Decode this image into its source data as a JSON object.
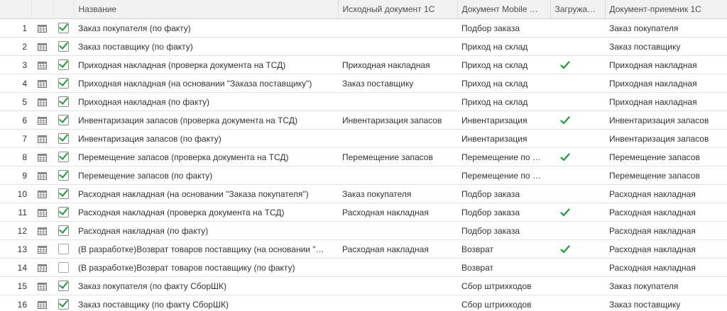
{
  "columns": {
    "name": "Название",
    "source_doc": "Исходный документ 1С",
    "mobile_doc": "Документ Mobile …",
    "loaded": "Загружа…",
    "target_doc": "Документ-приемник 1С"
  },
  "rows": [
    {
      "num": "1",
      "checked": true,
      "name": "Заказ покупателя (по факту)",
      "source_doc": "",
      "mobile_doc": "Подбор заказа",
      "loaded": false,
      "target_doc": "Заказ покупателя"
    },
    {
      "num": "2",
      "checked": true,
      "name": "Заказ поставщику (по факту)",
      "source_doc": "",
      "mobile_doc": "Приход на склад",
      "loaded": false,
      "target_doc": "Заказ поставщику"
    },
    {
      "num": "3",
      "checked": true,
      "name": "Приходная накладная (проверка документа на ТСД)",
      "source_doc": "Приходная накладная",
      "mobile_doc": "Приход на склад",
      "loaded": true,
      "target_doc": "Приходная накладная"
    },
    {
      "num": "4",
      "checked": true,
      "name": "Приходная накладная (на основании \"Заказа поставщику\")",
      "source_doc": "Заказ поставщику",
      "mobile_doc": "Приход на склад",
      "loaded": false,
      "target_doc": "Приходная накладная"
    },
    {
      "num": "5",
      "checked": true,
      "name": "Приходная накладная (по факту)",
      "source_doc": "",
      "mobile_doc": "Приход на склад",
      "loaded": false,
      "target_doc": "Приходная накладная"
    },
    {
      "num": "6",
      "checked": true,
      "name": "Инвентаризация запасов (проверка документа на ТСД)",
      "source_doc": "Инвентаризация запасов",
      "mobile_doc": "Инвентаризация",
      "loaded": true,
      "target_doc": "Инвентаризация запасов"
    },
    {
      "num": "7",
      "checked": true,
      "name": "Инвентаризация запасов (по факту)",
      "source_doc": "",
      "mobile_doc": "Инвентаризация",
      "loaded": false,
      "target_doc": "Инвентаризация запасов"
    },
    {
      "num": "8",
      "checked": true,
      "name": "Перемещение запасов (проверка документа на ТСД)",
      "source_doc": "Перемещение запасов",
      "mobile_doc": "Перемещение по …",
      "loaded": true,
      "target_doc": "Перемещение запасов"
    },
    {
      "num": "9",
      "checked": true,
      "name": "Перемещение запасов (по факту)",
      "source_doc": "",
      "mobile_doc": "Перемещение по …",
      "loaded": false,
      "target_doc": "Перемещение запасов"
    },
    {
      "num": "10",
      "checked": true,
      "name": "Расходная накладная (на основании \"Заказа покупателя\")",
      "source_doc": "Заказ покупателя",
      "mobile_doc": "Подбор заказа",
      "loaded": false,
      "target_doc": "Расходная накладная"
    },
    {
      "num": "11",
      "checked": true,
      "name": "Расходная накладная (проверка документа на ТСД)",
      "source_doc": "Расходная накладная",
      "mobile_doc": "Подбор заказа",
      "loaded": true,
      "target_doc": "Расходная накладная"
    },
    {
      "num": "12",
      "checked": true,
      "name": "Расходная накладная (по факту)",
      "source_doc": "",
      "mobile_doc": "Подбор заказа",
      "loaded": false,
      "target_doc": "Расходная накладная"
    },
    {
      "num": "13",
      "checked": false,
      "name": "(В разработке)Возврат товаров поставщику (на основании \"…",
      "source_doc": "Расходная накладная",
      "mobile_doc": "Возврат",
      "loaded": true,
      "target_doc": "Расходная накладная"
    },
    {
      "num": "14",
      "checked": false,
      "name": "(В разработке)Возврат товаров поставщику (по факту)",
      "source_doc": "",
      "mobile_doc": "Возврат",
      "loaded": false,
      "target_doc": "Расходная накладная"
    },
    {
      "num": "15",
      "checked": true,
      "name": "Заказ покупателя (по факту СборШК)",
      "source_doc": "",
      "mobile_doc": "Сбор штрихкодов",
      "loaded": false,
      "target_doc": "Заказ покупателя"
    },
    {
      "num": "16",
      "checked": true,
      "name": "Заказ поставщику (по факту СборШК)",
      "source_doc": "",
      "mobile_doc": "Сбор штрихкодов",
      "loaded": false,
      "target_doc": "Заказ поставщику"
    }
  ],
  "icons": {
    "row_icon": "table-icon",
    "loaded_icon": "checkmark-icon"
  },
  "colors": {
    "check_green": "#1f9a3a",
    "header_bg": "#f2f2f2",
    "grid_line": "#e4e4e4"
  }
}
